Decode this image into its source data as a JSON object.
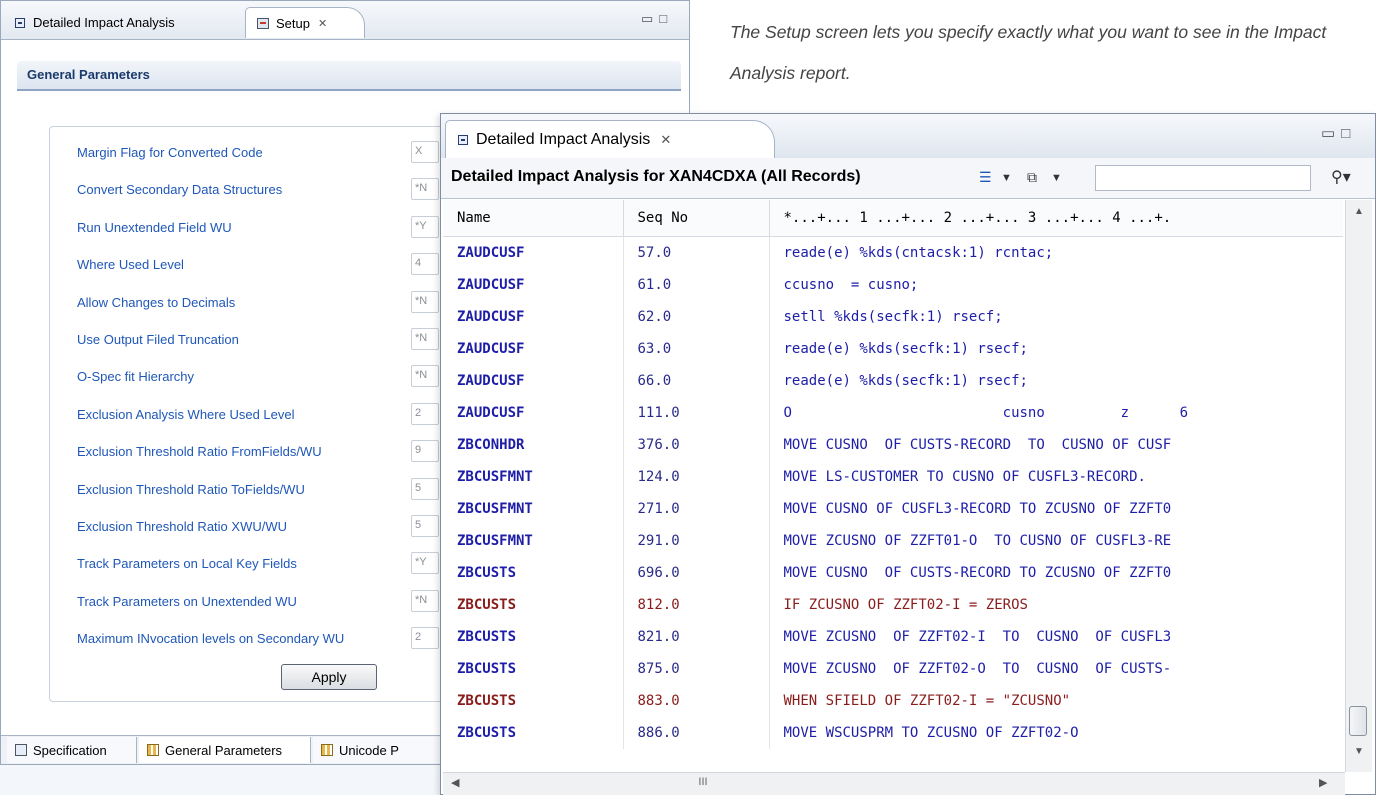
{
  "caption": {
    "text": "The Setup screen lets you specify exactly what you want to see in the Impact Analysis report."
  },
  "back_window": {
    "tabs": [
      {
        "label": "Detailed Impact Analysis",
        "active": false
      },
      {
        "label": "Setup",
        "active": true
      }
    ],
    "section_title": "General Parameters",
    "parameters": [
      {
        "label": "Margin Flag for Converted Code",
        "value": "X"
      },
      {
        "label": "Convert Secondary Data Structures",
        "value": "*N"
      },
      {
        "label": "Run Unextended Field WU",
        "value": "*Y"
      },
      {
        "label": "Where Used Level",
        "value": "4"
      },
      {
        "label": "Allow Changes to Decimals",
        "value": "*N"
      },
      {
        "label": "Use Output Filed Truncation",
        "value": "*N"
      },
      {
        "label": "O-Spec fit Hierarchy",
        "value": "*N"
      },
      {
        "label": "Exclusion Analysis Where Used Level",
        "value": "2"
      },
      {
        "label": "Exclusion Threshold Ratio FromFields/WU",
        "value": "9"
      },
      {
        "label": "Exclusion Threshold Ratio ToFields/WU",
        "value": "5"
      },
      {
        "label": "Exclusion Threshold Ratio XWU/WU",
        "value": "5"
      },
      {
        "label": "Track Parameters on Local Key Fields",
        "value": "*Y"
      },
      {
        "label": "Track Parameters on Unextended WU",
        "value": "*N"
      },
      {
        "label": "Maximum INvocation levels on Secondary WU",
        "value": "2"
      }
    ],
    "apply_label": "Apply",
    "bottom_tabs": [
      "Specification",
      "General Parameters",
      "Unicode P"
    ]
  },
  "front_window": {
    "tab_label": "Detailed Impact Analysis",
    "title": "Detailed Impact Analysis for XAN4CDXA (All Records)",
    "filter_value": "",
    "columns": [
      "Name",
      "Seq No",
      "*...+... 1 ...+... 2 ...+... 3 ...+... 4 ...+."
    ],
    "rows": [
      {
        "name": "ZAUDCUSF",
        "seq": "57.0",
        "code": "reade(e) %kds(cntacsk:1) rcntac;",
        "hl": false
      },
      {
        "name": "ZAUDCUSF",
        "seq": "61.0",
        "code": "ccusno  = cusno;",
        "hl": false
      },
      {
        "name": "ZAUDCUSF",
        "seq": "62.0",
        "code": "setll %kds(secfk:1) rsecf;",
        "hl": false
      },
      {
        "name": "ZAUDCUSF",
        "seq": "63.0",
        "code": "reade(e) %kds(secfk:1) rsecf;",
        "hl": false
      },
      {
        "name": "ZAUDCUSF",
        "seq": "66.0",
        "code": "reade(e) %kds(secfk:1) rsecf;",
        "hl": false
      },
      {
        "name": "ZAUDCUSF",
        "seq": "111.0",
        "code": "O                         cusno         z      6",
        "hl": false
      },
      {
        "name": "ZBCONHDR",
        "seq": "376.0",
        "code": "MOVE CUSNO  OF CUSTS-RECORD  TO  CUSNO OF CUSF",
        "hl": false
      },
      {
        "name": "ZBCUSFMNT",
        "seq": "124.0",
        "code": "MOVE LS-CUSTOMER TO CUSNO OF CUSFL3-RECORD.",
        "hl": false
      },
      {
        "name": "ZBCUSFMNT",
        "seq": "271.0",
        "code": "MOVE CUSNO OF CUSFL3-RECORD TO ZCUSNO OF ZZFT0",
        "hl": false
      },
      {
        "name": "ZBCUSFMNT",
        "seq": "291.0",
        "code": "MOVE ZCUSNO OF ZZFT01-O  TO CUSNO OF CUSFL3-RE",
        "hl": false
      },
      {
        "name": "ZBCUSTS",
        "seq": "696.0",
        "code": "MOVE CUSNO  OF CUSTS-RECORD TO ZCUSNO OF ZZFT0",
        "hl": false
      },
      {
        "name": "ZBCUSTS",
        "seq": "812.0",
        "code": "IF ZCUSNO OF ZZFT02-I = ZEROS",
        "hl": true
      },
      {
        "name": "ZBCUSTS",
        "seq": "821.0",
        "code": "MOVE ZCUSNO  OF ZZFT02-I  TO  CUSNO  OF CUSFL3",
        "hl": false
      },
      {
        "name": "ZBCUSTS",
        "seq": "875.0",
        "code": "MOVE ZCUSNO  OF ZZFT02-O  TO  CUSNO  OF CUSTS-",
        "hl": false
      },
      {
        "name": "ZBCUSTS",
        "seq": "883.0",
        "code": "WHEN SFIELD OF ZZFT02-I = \"ZCUSNO\"",
        "hl": true
      },
      {
        "name": "ZBCUSTS",
        "seq": "886.0",
        "code": "MOVE WSCUSPRM TO ZCUSNO OF ZZFT02-O",
        "hl": false
      }
    ],
    "horizontal_scroll_thumb": "III"
  },
  "colors": {
    "param_label": "#1f57b8",
    "name_text": "#1d1da8",
    "highlight_text": "#8a1c1c",
    "section_title": "#1b3a6b"
  },
  "icons": [
    "view-icon",
    "setup-icon",
    "close-icon",
    "minimize-icon",
    "maximize-icon",
    "list-icon",
    "dropdown-icon",
    "export-icon",
    "binoculars-icon",
    "specification-icon",
    "grid-icon",
    "unicode-icon"
  ]
}
